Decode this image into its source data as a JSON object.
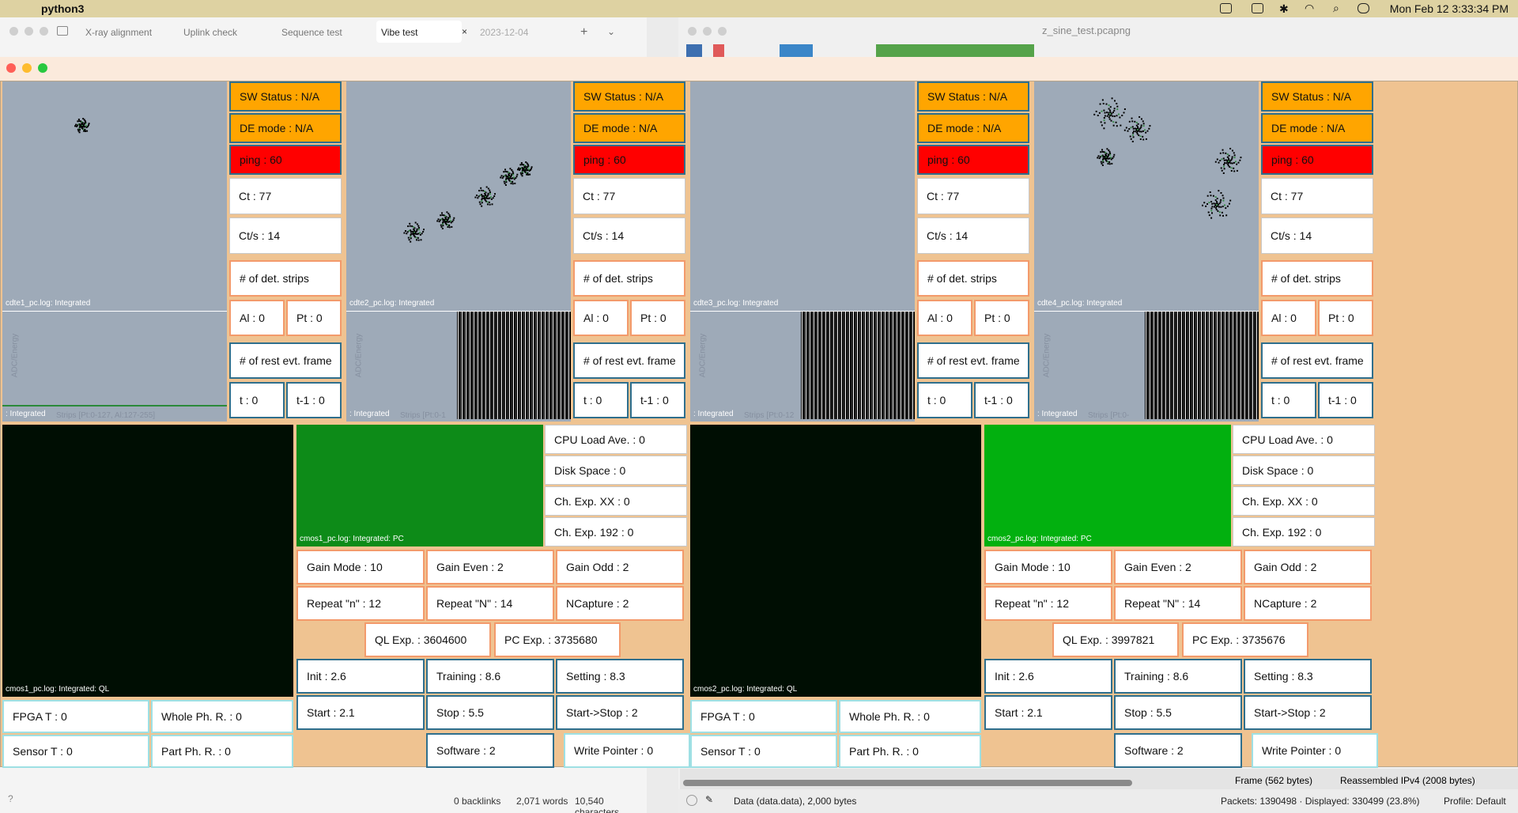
{
  "menubar": {
    "app": "python3",
    "clock": "Mon Feb 12  3:33:34 PM"
  },
  "editor": {
    "tabs": [
      "X-ray alignment",
      "Uplink check",
      "Sequence test",
      "Vibe test",
      "2023-12-04"
    ],
    "active_tab": "Vibe test",
    "status": {
      "backlinks": "0 backlinks",
      "words": "2,071 words",
      "characters": "10,540 characters"
    }
  },
  "wireshark": {
    "title": "z_sine_test.pcapng",
    "frame": "Frame (562 bytes)",
    "reassembled": "Reassembled IPv4 (2008 bytes)",
    "data": "Data (data.data), 2,000 bytes",
    "packets": "Packets: 1390498 · Displayed: 330499 (23.8%)",
    "profile": "Profile: Default"
  },
  "cdte": [
    {
      "plot_label": "cdte1_pc.log: Integrated",
      "spec_label": ": Integrated",
      "axis_x": "Strips [Pt:0-127, Al:127-255]",
      "axis_y": "ADC/Energy",
      "sw": "SW Status : N/A",
      "de": "DE mode : N/A",
      "ping": "ping : 60",
      "ct": "Ct : 77",
      "cts": "Ct/s : 14",
      "strips": "# of det. strips",
      "al": "Al : 0",
      "pt": "Pt : 0",
      "rest": "# of rest evt. frame",
      "t": "t : 0",
      "t1": "t-1 : 0"
    },
    {
      "plot_label": "cdte2_pc.log: Integrated",
      "spec_label": ": Integrated",
      "axis_x": "Strips [Pt:0-1",
      "axis_y": "ADC/Energy",
      "sw": "SW Status : N/A",
      "de": "DE mode : N/A",
      "ping": "ping : 60",
      "ct": "Ct : 77",
      "cts": "Ct/s : 14",
      "strips": "# of det. strips",
      "al": "Al : 0",
      "pt": "Pt : 0",
      "rest": "# of rest evt. frame",
      "t": "t : 0",
      "t1": "t-1 : 0"
    },
    {
      "plot_label": "cdte3_pc.log: Integrated",
      "spec_label": ": Integrated",
      "axis_x": "Strips [Pt:0-12",
      "axis_y": "ADC/Energy",
      "sw": "SW Status : N/A",
      "de": "DE mode : N/A",
      "ping": "ping : 60",
      "ct": "Ct : 77",
      "cts": "Ct/s : 14",
      "strips": "# of det. strips",
      "al": "Al : 0",
      "pt": "Pt : 0",
      "rest": "# of rest evt. frame",
      "t": "t : 0",
      "t1": "t-1 : 0"
    },
    {
      "plot_label": "cdte4_pc.log: Integrated",
      "spec_label": ": Integrated",
      "axis_x": "Strips [Pt:0-",
      "axis_y": "ADC/Energy",
      "sw": "SW Status : N/A",
      "de": "DE mode : N/A",
      "ping": "ping : 60",
      "ct": "Ct : 77",
      "cts": "Ct/s : 14",
      "strips": "# of det. strips",
      "al": "Al : 0",
      "pt": "Pt : 0",
      "rest": "# of rest evt. frame",
      "t": "t : 0",
      "t1": "t-1 : 0"
    }
  ],
  "cmos": [
    {
      "ql_label": "cmos1_pc.log: Integrated: QL",
      "pc_label": "cmos1_pc.log: Integrated: PC",
      "cpu": "CPU Load Ave. : 0",
      "disk": "Disk Space : 0",
      "chxx": "Ch. Exp. XX : 0",
      "ch192": "Ch. Exp. 192 : 0",
      "gain_mode": "Gain Mode : 10",
      "gain_even": "Gain Even : 2",
      "gain_odd": "Gain Odd : 2",
      "repeat_n": "Repeat \"n\" : 12",
      "repeat_N": "Repeat \"N\" : 14",
      "ncapture": "NCapture : 2",
      "ql_exp": "QL Exp. : 3604600",
      "pc_exp": "PC Exp. : 3735680",
      "init": "Init : 2.6",
      "training": "Training : 8.6",
      "setting": "Setting : 8.3",
      "start": "Start : 2.1",
      "stop": "Stop : 5.5",
      "startstop": "Start->Stop : 2",
      "software": "Software : 2",
      "write": "Write Pointer : 0",
      "fpga": "FPGA T : 0",
      "whole": "Whole Ph. R. : 0",
      "sensor": "Sensor T : 0",
      "part": "Part Ph. R. : 0"
    },
    {
      "ql_label": "cmos2_pc.log: Integrated: QL",
      "pc_label": "cmos2_pc.log: Integrated: PC",
      "cpu": "CPU Load Ave. : 0",
      "disk": "Disk Space : 0",
      "chxx": "Ch. Exp. XX : 0",
      "ch192": "Ch. Exp. 192 : 0",
      "gain_mode": "Gain Mode : 10",
      "gain_even": "Gain Even : 2",
      "gain_odd": "Gain Odd : 2",
      "repeat_n": "Repeat \"n\" : 12",
      "repeat_N": "Repeat \"N\" : 14",
      "ncapture": "NCapture : 2",
      "ql_exp": "QL Exp. : 3997821",
      "pc_exp": "PC Exp. : 3735676",
      "init": "Init : 2.6",
      "training": "Training : 8.6",
      "setting": "Setting : 8.3",
      "start": "Start : 2.1",
      "stop": "Stop : 5.5",
      "startstop": "Start->Stop : 2",
      "software": "Software : 2",
      "write": "Write Pointer : 0",
      "fpga": "FPGA T : 0",
      "whole": "Whole Ph. R. : 0",
      "sensor": "Sensor T : 0",
      "part": "Part Ph. R. : 0"
    }
  ],
  "colors": {
    "orange": "#ffa500",
    "red": "#ff0000",
    "plot_bg": "#9eaab8",
    "window_bg": "#efc391"
  }
}
